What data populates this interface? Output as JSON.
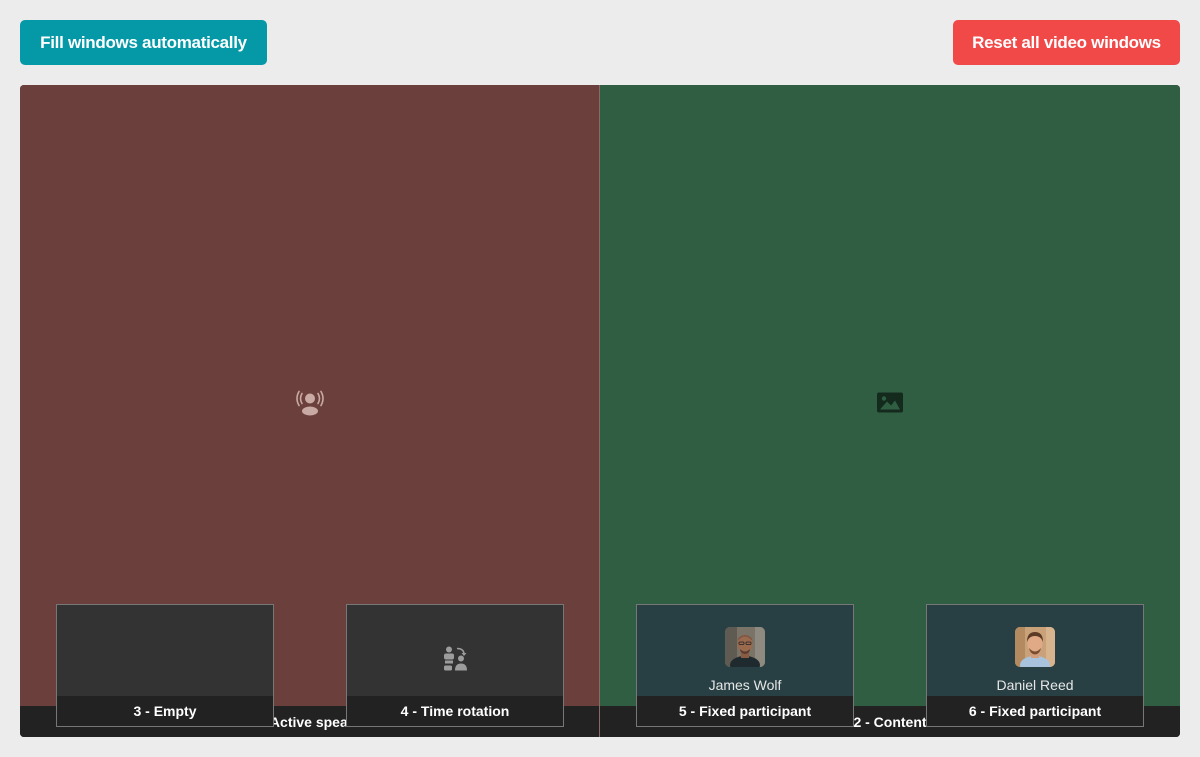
{
  "toolbar": {
    "fill_label": "Fill windows automatically",
    "reset_label": "Reset all video windows",
    "fill_color": "#0599a8",
    "reset_color": "#f14848"
  },
  "stage": {
    "left": {
      "label": "1 - Active speaker",
      "icon": "active-speaker-icon",
      "color": "#6b403c"
    },
    "right": {
      "label": "2 - Content",
      "icon": "image-icon",
      "color": "#305e43"
    }
  },
  "tiles": [
    {
      "label": "3 - Empty"
    },
    {
      "label": "4 - Time rotation",
      "icon": "time-rotation-icon"
    },
    {
      "label": "5 - Fixed participant",
      "participant": "James Wolf"
    },
    {
      "label": "6 - Fixed participant",
      "participant": "Daniel Reed"
    }
  ]
}
